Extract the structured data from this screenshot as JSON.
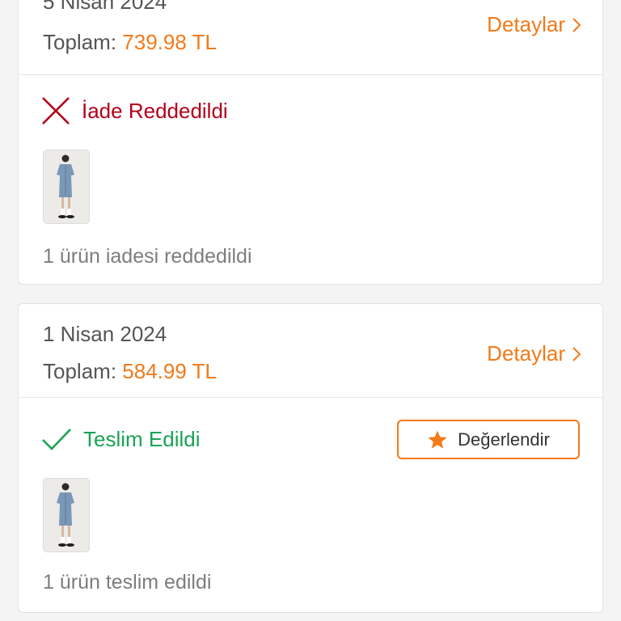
{
  "orders": [
    {
      "date": "5 Nisan 2024",
      "total_label": "Toplam:",
      "total_amount": "739.98 TL",
      "details_label": "Detaylar",
      "status_text": "İade Reddedildi",
      "status_icon": "close-icon",
      "status_color": "#b3001b",
      "summary": "1 ürün iadesi reddedildi"
    },
    {
      "date": "1 Nisan 2024",
      "total_label": "Toplam:",
      "total_amount": "584.99 TL",
      "details_label": "Detaylar",
      "status_text": "Teslim Edildi",
      "status_icon": "checkmark-icon",
      "status_color": "#1aa355",
      "rate_label": "Değerlendir",
      "summary": "1 ürün teslim edildi"
    }
  ],
  "colors": {
    "accent": "#f27a1a",
    "rejected": "#b3001b",
    "delivered": "#1aa355"
  }
}
